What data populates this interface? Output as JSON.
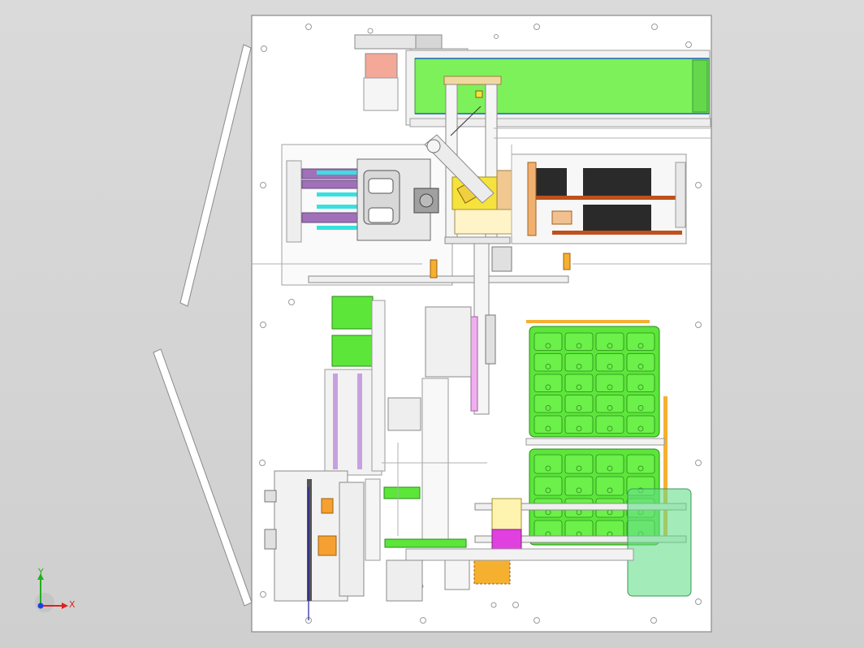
{
  "viewport": {
    "background": "#d4d4d4"
  },
  "triad": {
    "x_label": "X",
    "y_label": "Y",
    "x_color": "#e02020",
    "y_color": "#20b020",
    "z_color": "#2040e0"
  },
  "colors": {
    "plate": "#ffffff",
    "outline": "#8a8a8a",
    "conveyor": "#7cf15a",
    "tray_green": "#5ce63a",
    "yellow_block": "#f6e23c",
    "orange": "#f0a030",
    "purple": "#a070b8",
    "cyan": "#38e0e0",
    "magenta": "#e040e0",
    "salmon": "#f4a898",
    "dark_slot": "#2a2a2a",
    "rust": "#c0501c",
    "translucent_green": "#66dd88"
  }
}
